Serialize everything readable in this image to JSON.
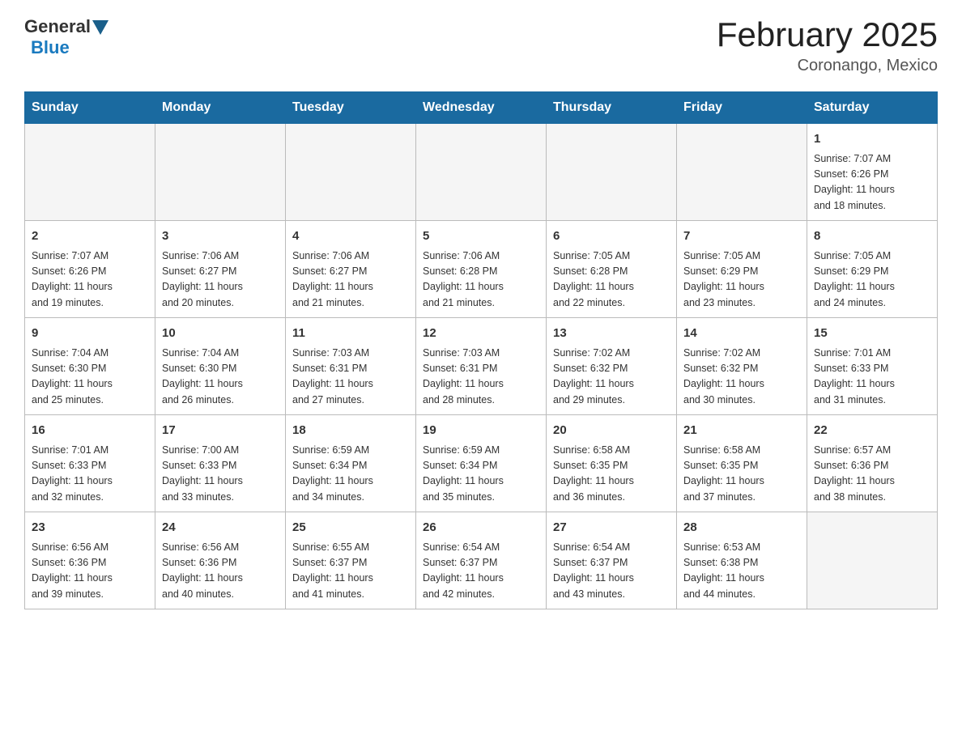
{
  "header": {
    "logo": {
      "general": "General",
      "blue": "Blue"
    },
    "title": "February 2025",
    "subtitle": "Coronango, Mexico"
  },
  "weekdays": [
    "Sunday",
    "Monday",
    "Tuesday",
    "Wednesday",
    "Thursday",
    "Friday",
    "Saturday"
  ],
  "weeks": [
    [
      {
        "day": "",
        "info": ""
      },
      {
        "day": "",
        "info": ""
      },
      {
        "day": "",
        "info": ""
      },
      {
        "day": "",
        "info": ""
      },
      {
        "day": "",
        "info": ""
      },
      {
        "day": "",
        "info": ""
      },
      {
        "day": "1",
        "info": "Sunrise: 7:07 AM\nSunset: 6:26 PM\nDaylight: 11 hours\nand 18 minutes."
      }
    ],
    [
      {
        "day": "2",
        "info": "Sunrise: 7:07 AM\nSunset: 6:26 PM\nDaylight: 11 hours\nand 19 minutes."
      },
      {
        "day": "3",
        "info": "Sunrise: 7:06 AM\nSunset: 6:27 PM\nDaylight: 11 hours\nand 20 minutes."
      },
      {
        "day": "4",
        "info": "Sunrise: 7:06 AM\nSunset: 6:27 PM\nDaylight: 11 hours\nand 21 minutes."
      },
      {
        "day": "5",
        "info": "Sunrise: 7:06 AM\nSunset: 6:28 PM\nDaylight: 11 hours\nand 21 minutes."
      },
      {
        "day": "6",
        "info": "Sunrise: 7:05 AM\nSunset: 6:28 PM\nDaylight: 11 hours\nand 22 minutes."
      },
      {
        "day": "7",
        "info": "Sunrise: 7:05 AM\nSunset: 6:29 PM\nDaylight: 11 hours\nand 23 minutes."
      },
      {
        "day": "8",
        "info": "Sunrise: 7:05 AM\nSunset: 6:29 PM\nDaylight: 11 hours\nand 24 minutes."
      }
    ],
    [
      {
        "day": "9",
        "info": "Sunrise: 7:04 AM\nSunset: 6:30 PM\nDaylight: 11 hours\nand 25 minutes."
      },
      {
        "day": "10",
        "info": "Sunrise: 7:04 AM\nSunset: 6:30 PM\nDaylight: 11 hours\nand 26 minutes."
      },
      {
        "day": "11",
        "info": "Sunrise: 7:03 AM\nSunset: 6:31 PM\nDaylight: 11 hours\nand 27 minutes."
      },
      {
        "day": "12",
        "info": "Sunrise: 7:03 AM\nSunset: 6:31 PM\nDaylight: 11 hours\nand 28 minutes."
      },
      {
        "day": "13",
        "info": "Sunrise: 7:02 AM\nSunset: 6:32 PM\nDaylight: 11 hours\nand 29 minutes."
      },
      {
        "day": "14",
        "info": "Sunrise: 7:02 AM\nSunset: 6:32 PM\nDaylight: 11 hours\nand 30 minutes."
      },
      {
        "day": "15",
        "info": "Sunrise: 7:01 AM\nSunset: 6:33 PM\nDaylight: 11 hours\nand 31 minutes."
      }
    ],
    [
      {
        "day": "16",
        "info": "Sunrise: 7:01 AM\nSunset: 6:33 PM\nDaylight: 11 hours\nand 32 minutes."
      },
      {
        "day": "17",
        "info": "Sunrise: 7:00 AM\nSunset: 6:33 PM\nDaylight: 11 hours\nand 33 minutes."
      },
      {
        "day": "18",
        "info": "Sunrise: 6:59 AM\nSunset: 6:34 PM\nDaylight: 11 hours\nand 34 minutes."
      },
      {
        "day": "19",
        "info": "Sunrise: 6:59 AM\nSunset: 6:34 PM\nDaylight: 11 hours\nand 35 minutes."
      },
      {
        "day": "20",
        "info": "Sunrise: 6:58 AM\nSunset: 6:35 PM\nDaylight: 11 hours\nand 36 minutes."
      },
      {
        "day": "21",
        "info": "Sunrise: 6:58 AM\nSunset: 6:35 PM\nDaylight: 11 hours\nand 37 minutes."
      },
      {
        "day": "22",
        "info": "Sunrise: 6:57 AM\nSunset: 6:36 PM\nDaylight: 11 hours\nand 38 minutes."
      }
    ],
    [
      {
        "day": "23",
        "info": "Sunrise: 6:56 AM\nSunset: 6:36 PM\nDaylight: 11 hours\nand 39 minutes."
      },
      {
        "day": "24",
        "info": "Sunrise: 6:56 AM\nSunset: 6:36 PM\nDaylight: 11 hours\nand 40 minutes."
      },
      {
        "day": "25",
        "info": "Sunrise: 6:55 AM\nSunset: 6:37 PM\nDaylight: 11 hours\nand 41 minutes."
      },
      {
        "day": "26",
        "info": "Sunrise: 6:54 AM\nSunset: 6:37 PM\nDaylight: 11 hours\nand 42 minutes."
      },
      {
        "day": "27",
        "info": "Sunrise: 6:54 AM\nSunset: 6:37 PM\nDaylight: 11 hours\nand 43 minutes."
      },
      {
        "day": "28",
        "info": "Sunrise: 6:53 AM\nSunset: 6:38 PM\nDaylight: 11 hours\nand 44 minutes."
      },
      {
        "day": "",
        "info": ""
      }
    ]
  ]
}
